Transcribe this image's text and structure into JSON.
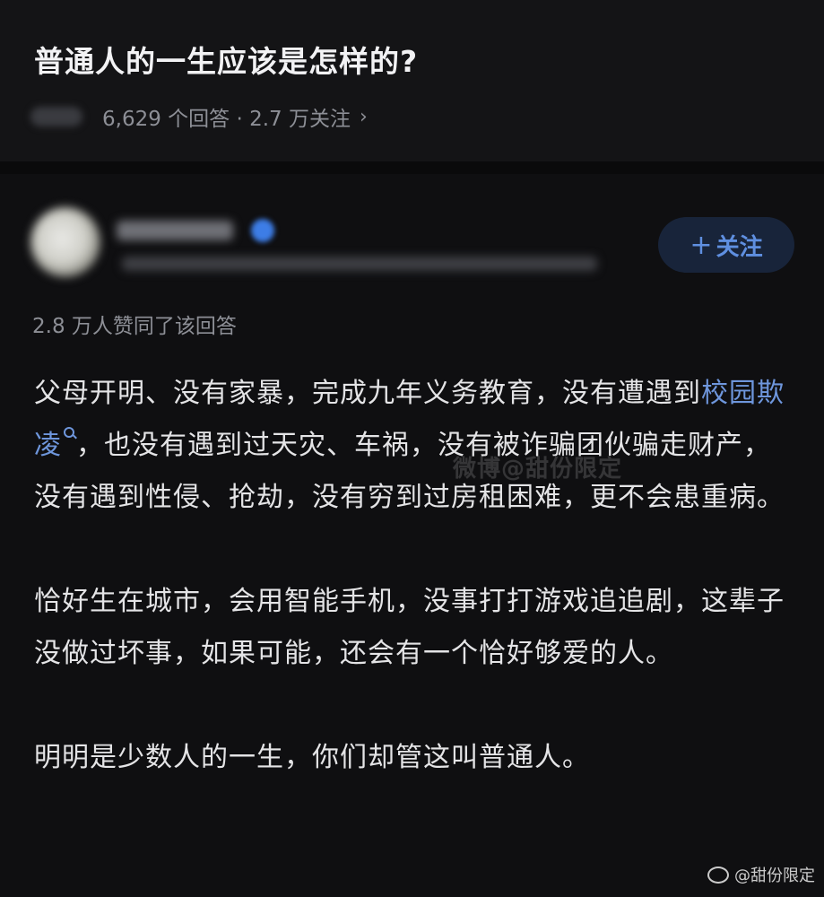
{
  "question": {
    "title": "普通人的一生应该是怎样的?",
    "stats": "6,629 个回答 · 2.7 万关注",
    "chevron": "›"
  },
  "answer": {
    "follow_plus": "+",
    "follow_label": "关注",
    "upvote_text": "2.8 万人赞同了该回答",
    "paragraph1_before_link": "父母开明、没有家暴，完成九年义务教育，没有遭遇到",
    "paragraph1_link": "校园欺凌",
    "paragraph1_after_link": "，也没有遇到过天灾、车祸，没有被诈骗团伙骗走财产，没有遇到性侵、抢劫，没有穷到过房租困难，更不会患重病。",
    "paragraph2": "恰好生在城市，会用智能手机，没事打打游戏追追剧，这辈子没做过坏事，如果可能，还会有一个恰好够爱的人。",
    "paragraph3": "明明是少数人的一生，你们却管这叫普通人。"
  },
  "watermarks": {
    "mid": "微博@甜份限定",
    "corner": "@甜份限定"
  },
  "colors": {
    "background": "#0f0f11",
    "link": "#6e96dc",
    "follow_button_bg": "#18243a"
  },
  "icons": {
    "search": "search-icon",
    "verified": "verified-icon",
    "weibo": "weibo-icon"
  }
}
